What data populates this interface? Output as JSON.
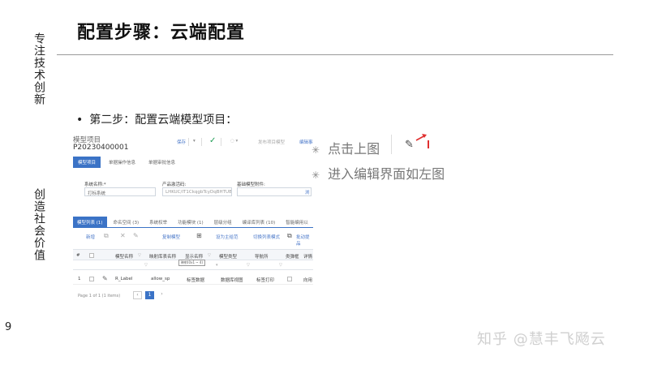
{
  "slide": {
    "title": "配置步骤：云端配置",
    "side_top": "专注技术创新",
    "side_bottom": "创造社会价值",
    "page_number": "9",
    "bullet_symbol": "•",
    "bullet": "第二步：配置云端模型项目：",
    "watermark": "知乎 @慧丰飞飏云"
  },
  "notes": {
    "star_symbol": "✳",
    "line1": "点击上图",
    "line2": "进入编辑界面如左图",
    "pencil_icon": "pencil-icon"
  },
  "shot": {
    "project_title": "模型项目",
    "project_code": "P20230400001",
    "top_actions": {
      "save": "保存",
      "save_caret": "▾",
      "confirm": "✓",
      "more": "◌ ▾",
      "publish": "发布项目模型",
      "edit": "编辑事"
    },
    "tabs": [
      "模型项目",
      "单据操作信息",
      "单据审批信息"
    ],
    "fields": {
      "system_name_label": "系统名称:*",
      "system_name_value": "打标系统",
      "product_key_label": "产品激活码:",
      "product_key_value": "LHKUC/IT1CkqgbTcyDqBHTUB",
      "base_model_label": "基础模型附件:",
      "base_model_btn": "浏"
    },
    "subtabs": [
      "模型列表 (1)",
      "命名空间 (3)",
      "系统权举",
      "功能模块 (1)",
      "层级分组",
      "编译库列表 (10)",
      "智能编用以"
    ],
    "toolbar": {
      "new": "新增",
      "copy_icon": "⧉",
      "delete_icon": "✕",
      "edit_icon": "✎",
      "copy_model": "复制模型",
      "add_icon": "⊞",
      "set_main": "设为主给范",
      "switch_mode": "切换列表模式",
      "copy_icon2": "⧉",
      "batch": "批动提品"
    },
    "grid": {
      "headers": [
        "#",
        "",
        "模型名称",
        "映射库表名称",
        "显示名称",
        "模型类型",
        "导航所",
        "类弹框",
        "详情"
      ],
      "filter_icon": "▽",
      "tooltip": "映射(0x1 ~ 4)",
      "row": {
        "index": "1",
        "edit_icon": "✎",
        "name": "R_Label",
        "table": "allow_sp",
        "display": "标签数据",
        "type": "数据库视图",
        "nav": "标签打印",
        "detail": "向用"
      }
    },
    "pager": {
      "text": "Page 1 of 1 (1 items)",
      "prev": "‹",
      "current": "1",
      "next": "›"
    }
  }
}
